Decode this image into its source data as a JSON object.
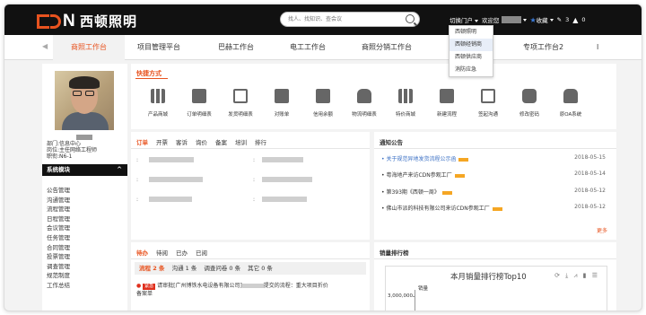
{
  "header": {
    "brand": "西顿照明",
    "search_placeholder": "找人、找知识、查会议",
    "switch_label": "切换门户",
    "welcome": "欢迎您",
    "favorites_label": "收藏",
    "edit_count": "3",
    "warn_count": "0"
  },
  "portal_menu": [
    "西顿照明",
    "西顿经销商",
    "西顿供应商",
    "消防应急"
  ],
  "nav": {
    "items": [
      "商照工作台",
      "项目管理平台",
      "巴赫工作台",
      "电工工作台",
      "商照分销工作台",
      "专项工作台2",
      "l"
    ]
  },
  "profile": {
    "dept": "部门:信息中心",
    "position": "岗位:主任网络工程师",
    "rank": "职衔:N6-1"
  },
  "sidebar": {
    "title": "系统模块",
    "items": [
      "公告管理",
      "沟通管理",
      "流程管理",
      "日程管理",
      "会议管理",
      "任务管理",
      "合同管理",
      "投票管理",
      "调查管理",
      "规范制度",
      "工作总结"
    ]
  },
  "quick": {
    "title": "快捷方式",
    "items": [
      "产品商城",
      "订单明细表",
      "发货明细表",
      "对账单",
      "信用余额",
      "物流明细表",
      "特价商城",
      "新建流程",
      "签起沟通",
      "修改密码",
      "原OA系统"
    ]
  },
  "orders": {
    "tabs": [
      "订单",
      "开票",
      "客诉",
      "询价",
      "备案",
      "培训",
      "排行"
    ]
  },
  "notices": {
    "title": "通知公告",
    "items": [
      {
        "text": "关于规范异地发货流程公示函",
        "date": "2018-05-15",
        "tag": true
      },
      {
        "text": "粤海地产来访CDN参观工厂",
        "date": "2018-05-14",
        "tag": true
      },
      {
        "text": "第393期《西顿一周》",
        "date": "2018-05-12",
        "tag": true
      },
      {
        "text": "佛山市派的科技有限公司来访CDN参观工厂",
        "date": "2018-05-12",
        "tag": true
      }
    ],
    "more": "更多"
  },
  "todo": {
    "tabs": [
      "待办",
      "待阅",
      "已办",
      "已阅"
    ],
    "subtabs": [
      "流程 2 条",
      "沟通 1 条",
      "调查问卷 0 条",
      "其它 0 条"
    ],
    "tag": "紧急",
    "item_text_a": "请审批[广州博铁水电设备有限公司]",
    "item_text_b": "提交的流程：重大项目折价",
    "item_text_c": "备案单"
  },
  "rank": {
    "title": "销量排行榜",
    "chart_title": "本月销量排行榜Top10",
    "tools": "⟳ ⤓ ⩘ ▮ ☰",
    "y_label": "销量",
    "y_tick": "3,000,000"
  },
  "chart_data": {
    "type": "bar",
    "title": "本月销量排行榜Top10",
    "ylabel": "销量",
    "yticks": [
      "3,000,000"
    ],
    "categories": [],
    "values": []
  }
}
